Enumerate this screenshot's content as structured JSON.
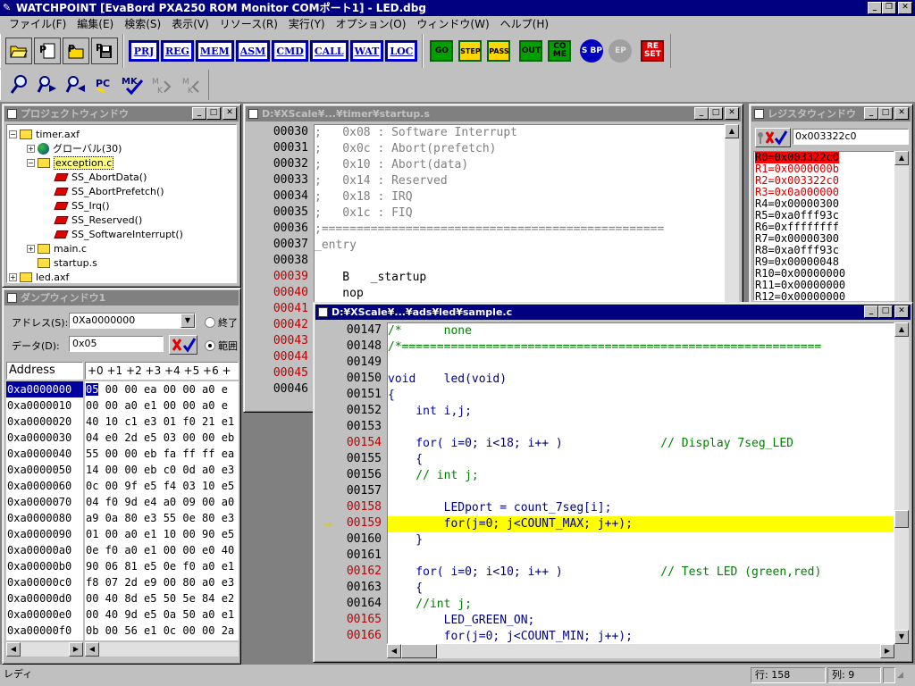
{
  "app": {
    "title": "WATCHPOINT [EvaBord PXA250 ROM Monitor COMポート1] - LED.dbg",
    "caption_buttons": [
      "_",
      "❐",
      "✕"
    ]
  },
  "menu": [
    "ファイル(F)",
    "編集(E)",
    "検索(S)",
    "表示(V)",
    "リソース(R)",
    "実行(Y)",
    "オプション(O)",
    "ウィンドウ(W)",
    "ヘルプ(H)"
  ],
  "toolbar": {
    "view_buttons": [
      "PRJ",
      "REG",
      "MEM",
      "ASM",
      "CMD",
      "CALL",
      "WAT",
      "LOC"
    ],
    "go": "GO",
    "step": "STEP",
    "pass": "PASS",
    "out": "OUT",
    "come": "CO ME",
    "sbp": "S BP",
    "ep": "EP",
    "reset": "RE SET",
    "mk": "MK",
    "mk2": "M K",
    "mk3": "M K"
  },
  "project_window": {
    "title": "プロジェクトウィンドウ",
    "tree": [
      {
        "label": "timer.axf",
        "indent": 0,
        "icon": "folder",
        "expander": "−"
      },
      {
        "label": "グローバル(30)",
        "indent": 1,
        "icon": "globe",
        "expander": "+"
      },
      {
        "label": "exception.c",
        "indent": 1,
        "icon": "folder",
        "expander": "−",
        "selected": true
      },
      {
        "label": "SS_AbortData()",
        "indent": 2,
        "icon": "func"
      },
      {
        "label": "SS_AbortPrefetch()",
        "indent": 2,
        "icon": "func"
      },
      {
        "label": "SS_Irq()",
        "indent": 2,
        "icon": "func"
      },
      {
        "label": "SS_Reserved()",
        "indent": 2,
        "icon": "func"
      },
      {
        "label": "SS_SoftwareInterrupt()",
        "indent": 2,
        "icon": "func"
      },
      {
        "label": "main.c",
        "indent": 1,
        "icon": "folder",
        "expander": "+"
      },
      {
        "label": "startup.s",
        "indent": 1,
        "icon": "folder"
      },
      {
        "label": "led.axf",
        "indent": 0,
        "icon": "folder",
        "expander": "+"
      }
    ]
  },
  "dump_window": {
    "title": "ダンプウィンドウ1",
    "address_label": "アドレス(S):",
    "address_value": "0Xa0000000",
    "data_label": "データ(D):",
    "data_value": "0x05",
    "radio_end": "終了",
    "radio_range": "範囲",
    "col_address": "Address",
    "col_offsets": "+0 +1 +2 +3 +4 +5 +6 +",
    "rows": [
      {
        "addr": "0xa0000000",
        "first": "05",
        "rest": " 00 00 ea 00 00 a0 e"
      },
      {
        "addr": "0xa0000010",
        "first": "00",
        "rest": " 00 a0 e1 00 00 a0 e"
      },
      {
        "addr": "0xa0000020",
        "first": "40",
        "rest": " 10 c1 e3 01 f0 21 e1 00 00 00"
      },
      {
        "addr": "0xa0000030",
        "first": "04",
        "rest": " e0 2d e5 03 00 00 eb 11 01 00"
      },
      {
        "addr": "0xa0000040",
        "first": "55",
        "rest": " 00 00 eb fa ff ff ea 04 e0 2c"
      },
      {
        "addr": "0xa0000050",
        "first": "14",
        "rest": " 00 00 eb c0 0d a0 e3 14 10 9f"
      },
      {
        "addr": "0xa0000060",
        "first": "0c",
        "rest": " 00 9f e5 f4 03 10 e5 a0 16 a0"
      },
      {
        "addr": "0xa0000070",
        "first": "04",
        "rest": " f0 9d e4 a0 09 00 a0 24 00 9f"
      },
      {
        "addr": "0xa0000080",
        "first": "a9",
        "rest": " 0a 80 e3 55 0e 80 e3 14 10 9f"
      },
      {
        "addr": "0xa0000090",
        "first": "01",
        "rest": " 00 a0 e1 10 00 90 e5 e0 0f 80"
      },
      {
        "addr": "0xa00000a0",
        "first": "0e",
        "rest": " f0 a0 e1 00 00 e0 40 00 00 a0"
      },
      {
        "addr": "0xa00000b0",
        "first": "90",
        "rest": " 06 81 e5 0e f0 a0 e1 00 10 30"
      },
      {
        "addr": "0xa00000c0",
        "first": "f8",
        "rest": " 07 2d e9 00 80 a0 e3 00 90 a0"
      },
      {
        "addr": "0xa00000d0",
        "first": "00",
        "rest": " 40 8d e5 50 5e 84 e2 05 a0 a0"
      },
      {
        "addr": "0xa00000e0",
        "first": "00",
        "rest": " 40 9d e5 0a 50 a0 e1 01 60 a0"
      },
      {
        "addr": "0xa00000f0",
        "first": "0b",
        "rest": " 00 56 e1 0c 00 00 2a 02 00 00"
      }
    ]
  },
  "startup_window": {
    "title": "D:¥XScale¥...¥timer¥startup.s",
    "lines": [
      {
        "n": "00030",
        "bp": false,
        "text": ";   0x08 : Software Interrupt",
        "cls": "comment"
      },
      {
        "n": "00031",
        "bp": false,
        "text": ";   0x0c : Abort(prefetch)",
        "cls": "comment"
      },
      {
        "n": "00032",
        "bp": false,
        "text": ";   0x10 : Abort(data)",
        "cls": "comment"
      },
      {
        "n": "00033",
        "bp": false,
        "text": ";   0x14 : Reserved",
        "cls": "comment"
      },
      {
        "n": "00034",
        "bp": false,
        "text": ";   0x18 : IRQ",
        "cls": "comment"
      },
      {
        "n": "00035",
        "bp": false,
        "text": ";   0x1c : FIQ",
        "cls": "comment"
      },
      {
        "n": "00036",
        "bp": false,
        "text": ";=================================================",
        "cls": "comment"
      },
      {
        "n": "00037",
        "bp": false,
        "text": "_entry",
        "cls": "label"
      },
      {
        "n": "00038",
        "bp": false,
        "text": "",
        "cls": "code"
      },
      {
        "n": "00039",
        "bp": true,
        "text": "    B   _startup",
        "cls": "code"
      },
      {
        "n": "00040",
        "bp": true,
        "text": "    nop",
        "cls": "code"
      },
      {
        "n": "00041",
        "bp": true,
        "text": "",
        "cls": "code"
      },
      {
        "n": "00042",
        "bp": true,
        "text": "",
        "cls": "code"
      },
      {
        "n": "00043",
        "bp": true,
        "text": "",
        "cls": "code"
      },
      {
        "n": "00044",
        "bp": true,
        "text": "",
        "cls": "code"
      },
      {
        "n": "00045",
        "bp": true,
        "text": "",
        "cls": "code"
      },
      {
        "n": "00046",
        "bp": false,
        "text": "",
        "cls": "code"
      }
    ]
  },
  "register_window": {
    "title": "レジスタウィンドウ",
    "input_value": "0x003322c0",
    "registers": [
      {
        "text": "R0=0x003322c0",
        "hl": true,
        "color": "#000000"
      },
      {
        "text": "R1=0x0000000b",
        "hl": false,
        "color": "#d00000"
      },
      {
        "text": "R2=0x003322c0",
        "hl": false,
        "color": "#d00000"
      },
      {
        "text": "R3=0x0a000000",
        "hl": false,
        "color": "#d00000"
      },
      {
        "text": "R4=0x00000300",
        "hl": false,
        "color": "#000000"
      },
      {
        "text": "R5=0xa0fff93c",
        "hl": false,
        "color": "#000000"
      },
      {
        "text": "R6=0xffffffff",
        "hl": false,
        "color": "#000000"
      },
      {
        "text": "R7=0x00000300",
        "hl": false,
        "color": "#000000"
      },
      {
        "text": "R8=0xa0fff93c",
        "hl": false,
        "color": "#000000"
      },
      {
        "text": "R9=0x00000048",
        "hl": false,
        "color": "#000000"
      },
      {
        "text": "R10=0x00000000",
        "hl": false,
        "color": "#000000"
      },
      {
        "text": "R11=0x00000000",
        "hl": false,
        "color": "#000000"
      },
      {
        "text": "R12=0x00000000",
        "hl": false,
        "color": "#000000"
      }
    ]
  },
  "sample_window": {
    "title": "D:¥XScale¥...¥ads¥led¥sample.c",
    "lines": [
      {
        "n": "00147",
        "bp": false,
        "cur": false,
        "parts": [
          [
            "/*      none",
            "c"
          ]
        ]
      },
      {
        "n": "00148",
        "bp": false,
        "cur": false,
        "parts": [
          [
            "/*============================================================",
            "c"
          ]
        ]
      },
      {
        "n": "00149",
        "bp": false,
        "cur": false,
        "parts": []
      },
      {
        "n": "00150",
        "bp": false,
        "cur": false,
        "parts": [
          [
            "void",
            "k"
          ],
          [
            "    ",
            "n"
          ],
          [
            "led(void)",
            "f"
          ]
        ]
      },
      {
        "n": "00151",
        "bp": false,
        "cur": false,
        "parts": [
          [
            "{",
            "f"
          ]
        ]
      },
      {
        "n": "00152",
        "bp": false,
        "cur": false,
        "parts": [
          [
            "    int",
            "k"
          ],
          [
            " i,j;",
            "f"
          ]
        ]
      },
      {
        "n": "00153",
        "bp": false,
        "cur": false,
        "parts": []
      },
      {
        "n": "00154",
        "bp": true,
        "cur": false,
        "parts": [
          [
            "    for",
            "k"
          ],
          [
            "( i=0; i<18; i++ )",
            "n"
          ],
          [
            "              // Display 7seg_LED",
            "c"
          ]
        ]
      },
      {
        "n": "00155",
        "bp": false,
        "cur": false,
        "parts": [
          [
            "    {",
            "f"
          ]
        ]
      },
      {
        "n": "00156",
        "bp": false,
        "cur": false,
        "parts": [
          [
            "    // int j;",
            "c"
          ]
        ]
      },
      {
        "n": "00157",
        "bp": false,
        "cur": false,
        "parts": []
      },
      {
        "n": "00158",
        "bp": true,
        "cur": false,
        "parts": [
          [
            "        LEDport = count_7seg[i];",
            "n"
          ]
        ]
      },
      {
        "n": "00159",
        "bp": true,
        "cur": true,
        "parts": [
          [
            "        for(j=0; j<COUNT_MAX; j++);",
            "n"
          ]
        ]
      },
      {
        "n": "00160",
        "bp": false,
        "cur": false,
        "parts": [
          [
            "    }",
            "f"
          ]
        ]
      },
      {
        "n": "00161",
        "bp": false,
        "cur": false,
        "parts": []
      },
      {
        "n": "00162",
        "bp": true,
        "cur": false,
        "parts": [
          [
            "    for",
            "k"
          ],
          [
            "( i=0; i<10; i++ )",
            "n"
          ],
          [
            "              // Test LED (green,red)",
            "c"
          ]
        ]
      },
      {
        "n": "00163",
        "bp": false,
        "cur": false,
        "parts": [
          [
            "    {",
            "f"
          ]
        ]
      },
      {
        "n": "00164",
        "bp": false,
        "cur": false,
        "parts": [
          [
            "    //int j;",
            "c"
          ]
        ]
      },
      {
        "n": "00165",
        "bp": true,
        "cur": false,
        "parts": [
          [
            "        LED_GREEN_ON;",
            "n"
          ]
        ]
      },
      {
        "n": "00166",
        "bp": true,
        "cur": false,
        "parts": [
          [
            "        for(j=0; j<COUNT_MIN; j++);",
            "n"
          ]
        ]
      }
    ]
  },
  "status": {
    "left": "レディ",
    "line": "行: 158",
    "col": "列: 9"
  },
  "colors": {
    "titlebar": "#000080",
    "current_line": "#ffff00",
    "comment": "#008000",
    "keyword": "#0000c0",
    "breakpoint": "#c00000",
    "register_highlight": "#ff0000"
  }
}
